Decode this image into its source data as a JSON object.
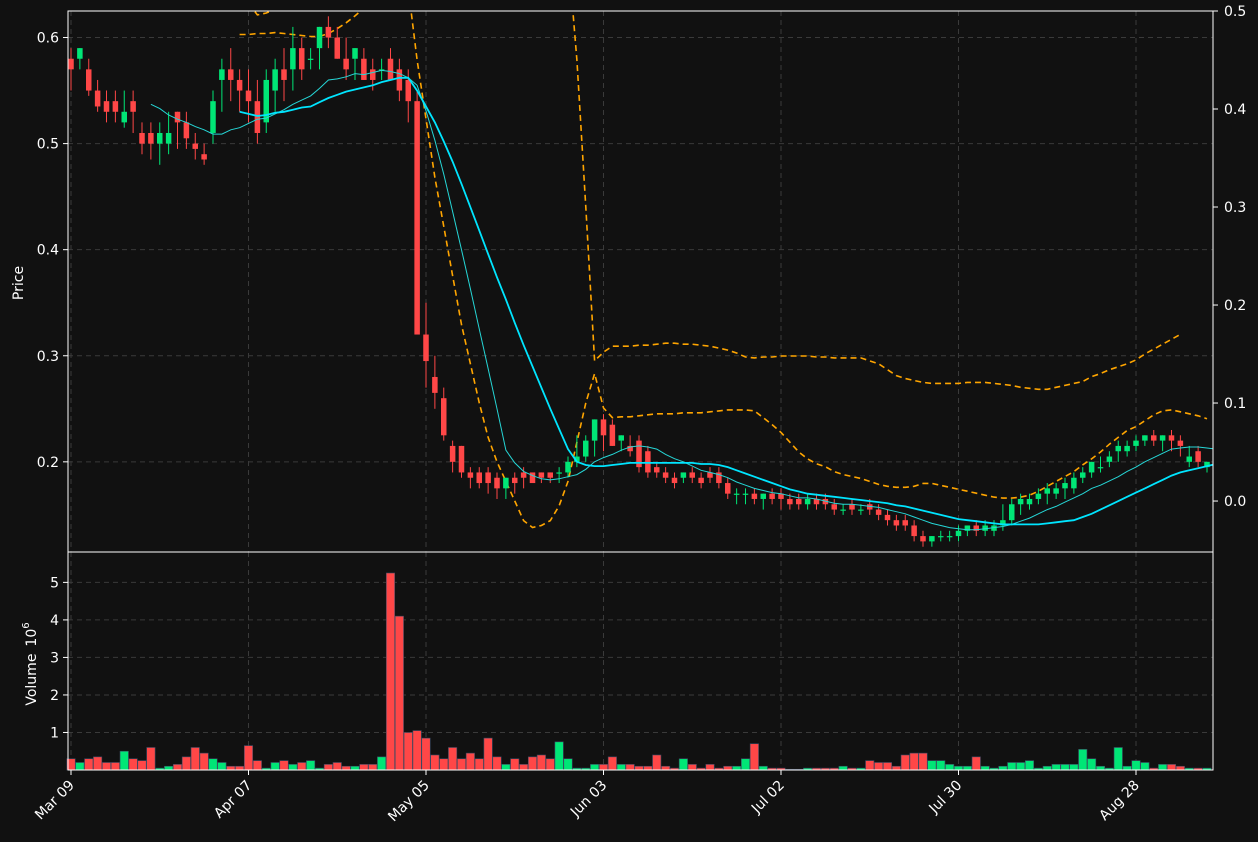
{
  "chart_data": {
    "type": "candlestick",
    "colors": {
      "background": "#111111",
      "up": "#00e676",
      "down": "#ff4747",
      "ma_fast": "#26d7d7",
      "ma_slow": "#00e5ff",
      "bands": "#ffa500",
      "axes": "#ffffff",
      "grid": "#3a3a3a"
    },
    "price_panel": {
      "ylabel": "Price",
      "ylim": [
        0.115,
        0.625
      ],
      "yticks": [
        "0.2",
        "0.3",
        "0.4",
        "0.5",
        "0.6"
      ],
      "right_ylim": [
        -0.052,
        0.5
      ],
      "right_yticks": [
        "0.0",
        "0.1",
        "0.2",
        "0.3",
        "0.4",
        "0.5"
      ]
    },
    "volume_panel": {
      "ylabel": "Volume",
      "ylabel_exponent": "10",
      "ylabel_exponent_power": "6",
      "ylim": [
        0,
        5.25
      ],
      "yticks": [
        "1",
        "2",
        "3",
        "4",
        "5"
      ]
    },
    "x_ticks": [
      {
        "index": 0,
        "label": "Mar 09"
      },
      {
        "index": 20,
        "label": "Apr 07"
      },
      {
        "index": 40,
        "label": "May 05"
      },
      {
        "index": 60,
        "label": "Jun 03"
      },
      {
        "index": 80,
        "label": "Jul 02"
      },
      {
        "index": 100,
        "label": "Jul 30"
      },
      {
        "index": 120,
        "label": "Aug 28"
      }
    ],
    "dates": [
      "2021-03-09",
      "2021-03-10",
      "2021-03-11",
      "2021-03-12",
      "2021-03-15",
      "2021-03-16",
      "2021-03-17",
      "2021-03-18",
      "2021-03-19",
      "2021-03-22",
      "2021-03-23",
      "2021-03-24",
      "2021-03-25",
      "2021-03-26",
      "2021-03-29",
      "2021-03-30",
      "2021-03-31",
      "2021-04-01",
      "2021-04-05",
      "2021-04-06",
      "2021-04-07",
      "2021-04-08",
      "2021-04-09",
      "2021-04-12",
      "2021-04-13",
      "2021-04-14",
      "2021-04-15",
      "2021-04-16",
      "2021-04-19",
      "2021-04-20",
      "2021-04-21",
      "2021-04-22",
      "2021-04-23",
      "2021-04-26",
      "2021-04-27",
      "2021-04-28",
      "2021-04-29",
      "2021-04-30",
      "2021-05-03",
      "2021-05-04",
      "2021-05-05",
      "2021-05-06",
      "2021-05-07",
      "2021-05-10",
      "2021-05-11",
      "2021-05-12",
      "2021-05-13",
      "2021-05-14",
      "2021-05-17",
      "2021-05-18",
      "2021-05-19",
      "2021-05-20",
      "2021-05-21",
      "2021-05-24",
      "2021-05-25",
      "2021-05-26",
      "2021-05-27",
      "2021-05-28",
      "2021-06-01",
      "2021-06-02",
      "2021-06-03",
      "2021-06-04",
      "2021-06-07",
      "2021-06-08",
      "2021-06-09",
      "2021-06-10",
      "2021-06-11",
      "2021-06-14",
      "2021-06-15",
      "2021-06-16",
      "2021-06-17",
      "2021-06-18",
      "2021-06-21",
      "2021-06-22",
      "2021-06-23",
      "2021-06-24",
      "2021-06-25",
      "2021-06-28",
      "2021-06-29",
      "2021-06-30",
      "2021-07-02",
      "2021-07-05",
      "2021-07-06",
      "2021-07-07",
      "2021-07-08",
      "2021-07-09",
      "2021-07-12",
      "2021-07-13",
      "2021-07-14",
      "2021-07-15",
      "2021-07-16",
      "2021-07-19",
      "2021-07-20",
      "2021-07-21",
      "2021-07-22",
      "2021-07-23",
      "2021-07-26",
      "2021-07-27",
      "2021-07-28",
      "2021-07-29",
      "2021-07-30",
      "2021-08-02",
      "2021-08-03",
      "2021-08-04",
      "2021-08-05",
      "2021-08-06",
      "2021-08-09",
      "2021-08-10",
      "2021-08-11",
      "2021-08-12",
      "2021-08-13",
      "2021-08-16",
      "2021-08-17",
      "2021-08-18",
      "2021-08-19",
      "2021-08-20",
      "2021-08-23",
      "2021-08-24",
      "2021-08-25",
      "2021-08-26",
      "2021-08-28",
      "2021-08-30",
      "2021-08-31",
      "2021-09-01",
      "2021-09-02",
      "2021-09-03",
      "2021-09-06",
      "2021-09-07"
    ],
    "open": [
      0.58,
      0.58,
      0.57,
      0.55,
      0.54,
      0.54,
      0.52,
      0.54,
      0.51,
      0.51,
      0.5,
      0.5,
      0.53,
      0.52,
      0.5,
      0.49,
      0.51,
      0.56,
      0.57,
      0.56,
      0.55,
      0.54,
      0.52,
      0.55,
      0.57,
      0.57,
      0.59,
      0.58,
      0.59,
      0.61,
      0.6,
      0.58,
      0.58,
      0.58,
      0.57,
      0.57,
      0.58,
      0.57,
      0.56,
      0.54,
      0.32,
      0.28,
      0.26,
      0.215,
      0.215,
      0.19,
      0.19,
      0.19,
      0.185,
      0.175,
      0.185,
      0.19,
      0.19,
      0.19,
      0.19,
      0.19,
      0.19,
      0.2,
      0.205,
      0.22,
      0.24,
      0.235,
      0.22,
      0.215,
      0.22,
      0.21,
      0.195,
      0.19,
      0.185,
      0.185,
      0.19,
      0.185,
      0.19,
      0.19,
      0.18,
      0.17,
      0.17,
      0.17,
      0.165,
      0.17,
      0.17,
      0.165,
      0.165,
      0.16,
      0.165,
      0.165,
      0.16,
      0.155,
      0.16,
      0.155,
      0.16,
      0.155,
      0.15,
      0.145,
      0.145,
      0.14,
      0.13,
      0.125,
      0.13,
      0.13,
      0.13,
      0.135,
      0.14,
      0.135,
      0.135,
      0.14,
      0.145,
      0.16,
      0.16,
      0.165,
      0.17,
      0.17,
      0.175,
      0.175,
      0.185,
      0.19,
      0.195,
      0.2,
      0.21,
      0.21,
      0.215,
      0.22,
      0.225,
      0.22,
      0.225,
      0.22,
      0.2,
      0.21,
      0.195
    ],
    "high": [
      0.59,
      0.59,
      0.58,
      0.56,
      0.55,
      0.55,
      0.55,
      0.55,
      0.52,
      0.52,
      0.52,
      0.53,
      0.53,
      0.53,
      0.51,
      0.5,
      0.55,
      0.58,
      0.59,
      0.57,
      0.57,
      0.56,
      0.57,
      0.58,
      0.59,
      0.61,
      0.6,
      0.59,
      0.61,
      0.62,
      0.61,
      0.6,
      0.59,
      0.59,
      0.58,
      0.58,
      0.59,
      0.58,
      0.57,
      0.55,
      0.35,
      0.3,
      0.27,
      0.22,
      0.215,
      0.195,
      0.195,
      0.195,
      0.19,
      0.185,
      0.19,
      0.195,
      0.19,
      0.19,
      0.19,
      0.195,
      0.205,
      0.225,
      0.225,
      0.24,
      0.245,
      0.24,
      0.225,
      0.225,
      0.225,
      0.215,
      0.2,
      0.195,
      0.19,
      0.19,
      0.195,
      0.19,
      0.195,
      0.195,
      0.185,
      0.175,
      0.175,
      0.175,
      0.17,
      0.175,
      0.175,
      0.17,
      0.17,
      0.17,
      0.17,
      0.17,
      0.165,
      0.16,
      0.165,
      0.16,
      0.165,
      0.16,
      0.155,
      0.15,
      0.15,
      0.145,
      0.135,
      0.13,
      0.135,
      0.135,
      0.14,
      0.14,
      0.145,
      0.145,
      0.145,
      0.16,
      0.165,
      0.17,
      0.17,
      0.175,
      0.18,
      0.18,
      0.185,
      0.19,
      0.195,
      0.2,
      0.205,
      0.21,
      0.22,
      0.22,
      0.225,
      0.225,
      0.23,
      0.225,
      0.23,
      0.225,
      0.215,
      0.215,
      0.2
    ],
    "low": [
      0.55,
      0.57,
      0.545,
      0.53,
      0.52,
      0.52,
      0.515,
      0.51,
      0.49,
      0.485,
      0.48,
      0.49,
      0.495,
      0.495,
      0.485,
      0.48,
      0.5,
      0.53,
      0.54,
      0.53,
      0.52,
      0.5,
      0.51,
      0.53,
      0.54,
      0.55,
      0.56,
      0.57,
      0.57,
      0.59,
      0.58,
      0.56,
      0.56,
      0.56,
      0.55,
      0.56,
      0.56,
      0.54,
      0.52,
      0.53,
      0.27,
      0.25,
      0.22,
      0.19,
      0.185,
      0.175,
      0.175,
      0.17,
      0.165,
      0.165,
      0.17,
      0.175,
      0.18,
      0.18,
      0.18,
      0.18,
      0.185,
      0.195,
      0.2,
      0.205,
      0.21,
      0.215,
      0.21,
      0.205,
      0.19,
      0.185,
      0.185,
      0.18,
      0.175,
      0.18,
      0.18,
      0.175,
      0.18,
      0.175,
      0.165,
      0.16,
      0.16,
      0.16,
      0.155,
      0.16,
      0.155,
      0.155,
      0.155,
      0.155,
      0.155,
      0.155,
      0.15,
      0.15,
      0.15,
      0.15,
      0.15,
      0.145,
      0.14,
      0.135,
      0.135,
      0.125,
      0.12,
      0.12,
      0.125,
      0.125,
      0.125,
      0.13,
      0.13,
      0.13,
      0.13,
      0.135,
      0.14,
      0.15,
      0.155,
      0.16,
      0.16,
      0.165,
      0.165,
      0.17,
      0.18,
      0.185,
      0.19,
      0.195,
      0.2,
      0.205,
      0.21,
      0.215,
      0.215,
      0.21,
      0.21,
      0.205,
      0.195,
      0.195,
      0.19
    ],
    "close": [
      0.57,
      0.59,
      0.55,
      0.535,
      0.53,
      0.53,
      0.53,
      0.53,
      0.5,
      0.5,
      0.51,
      0.51,
      0.52,
      0.505,
      0.495,
      0.485,
      0.54,
      0.57,
      0.56,
      0.55,
      0.54,
      0.51,
      0.56,
      0.57,
      0.56,
      0.59,
      0.57,
      0.58,
      0.61,
      0.6,
      0.58,
      0.57,
      0.59,
      0.56,
      0.56,
      0.57,
      0.56,
      0.55,
      0.54,
      0.32,
      0.295,
      0.265,
      0.225,
      0.2,
      0.19,
      0.185,
      0.18,
      0.18,
      0.175,
      0.185,
      0.18,
      0.185,
      0.18,
      0.185,
      0.185,
      0.19,
      0.2,
      0.205,
      0.22,
      0.24,
      0.225,
      0.215,
      0.225,
      0.21,
      0.195,
      0.19,
      0.19,
      0.185,
      0.18,
      0.19,
      0.185,
      0.18,
      0.185,
      0.18,
      0.17,
      0.17,
      0.17,
      0.165,
      0.17,
      0.165,
      0.165,
      0.16,
      0.16,
      0.165,
      0.16,
      0.16,
      0.155,
      0.155,
      0.155,
      0.155,
      0.155,
      0.15,
      0.145,
      0.14,
      0.14,
      0.13,
      0.125,
      0.13,
      0.13,
      0.13,
      0.135,
      0.14,
      0.135,
      0.14,
      0.14,
      0.145,
      0.16,
      0.165,
      0.165,
      0.17,
      0.175,
      0.175,
      0.18,
      0.185,
      0.19,
      0.2,
      0.195,
      0.205,
      0.215,
      0.215,
      0.22,
      0.225,
      0.22,
      0.225,
      0.22,
      0.215,
      0.205,
      0.2,
      0.2
    ],
    "volume": [
      0.3,
      0.2,
      0.3,
      0.35,
      0.2,
      0.2,
      0.5,
      0.3,
      0.25,
      0.6,
      0.05,
      0.1,
      0.15,
      0.35,
      0.6,
      0.45,
      0.3,
      0.2,
      0.1,
      0.1,
      0.65,
      0.25,
      0.05,
      0.2,
      0.25,
      0.15,
      0.2,
      0.25,
      0.05,
      0.15,
      0.2,
      0.1,
      0.1,
      0.15,
      0.15,
      0.35,
      5.25,
      4.1,
      1.0,
      1.05,
      0.85,
      0.4,
      0.3,
      0.6,
      0.3,
      0.45,
      0.3,
      0.85,
      0.35,
      0.15,
      0.3,
      0.15,
      0.35,
      0.4,
      0.3,
      0.75,
      0.3,
      0.05,
      0.05,
      0.15,
      0.15,
      0.35,
      0.15,
      0.15,
      0.1,
      0.1,
      0.4,
      0.1,
      0.05,
      0.3,
      0.15,
      0.05,
      0.15,
      0.05,
      0.1,
      0.1,
      0.3,
      0.7,
      0.1,
      0.05,
      0.05,
      0.02,
      0.02,
      0.05,
      0.05,
      0.05,
      0.05,
      0.1,
      0.05,
      0.05,
      0.25,
      0.2,
      0.2,
      0.1,
      0.4,
      0.45,
      0.45,
      0.25,
      0.25,
      0.15,
      0.1,
      0.1,
      0.35,
      0.1,
      0.05,
      0.1,
      0.2,
      0.2,
      0.25,
      0.05,
      0.1,
      0.15,
      0.15,
      0.15,
      0.55,
      0.3,
      0.1,
      0.05,
      0.6,
      0.1,
      0.25,
      0.2,
      0.05,
      0.15,
      0.15,
      0.1,
      0.05,
      0.05,
      0.05
    ],
    "ma_fast": [
      null,
      null,
      null,
      null,
      null,
      null,
      null,
      null,
      null,
      0.537,
      0.533,
      0.527,
      0.523,
      0.52,
      0.516,
      0.513,
      0.509,
      0.509,
      0.513,
      0.515,
      0.519,
      0.523,
      0.524,
      0.528,
      0.532,
      0.537,
      0.541,
      0.545,
      0.552,
      0.56,
      0.561,
      0.563,
      0.566,
      0.565,
      0.567,
      0.569,
      0.568,
      0.566,
      0.562,
      0.555,
      0.531,
      0.503,
      0.471,
      0.436,
      0.4,
      0.363,
      0.325,
      0.288,
      0.25,
      0.211,
      0.199,
      0.191,
      0.187,
      0.184,
      0.183,
      0.184,
      0.186,
      0.188,
      0.193,
      0.2,
      0.204,
      0.207,
      0.211,
      0.214,
      0.215,
      0.214,
      0.212,
      0.207,
      0.203,
      0.2,
      0.196,
      0.192,
      0.19,
      0.188,
      0.185,
      0.181,
      0.178,
      0.175,
      0.173,
      0.171,
      0.17,
      0.168,
      0.166,
      0.166,
      0.165,
      0.163,
      0.161,
      0.16,
      0.16,
      0.159,
      0.158,
      0.157,
      0.155,
      0.153,
      0.151,
      0.148,
      0.145,
      0.142,
      0.14,
      0.138,
      0.137,
      0.136,
      0.136,
      0.137,
      0.138,
      0.139,
      0.141,
      0.144,
      0.147,
      0.151,
      0.155,
      0.158,
      0.162,
      0.166,
      0.17,
      0.175,
      0.178,
      0.182,
      0.186,
      0.191,
      0.195,
      0.2,
      0.204,
      0.208,
      0.212,
      0.213,
      0.214,
      0.214,
      0.213,
      0.212,
      0.211
    ],
    "ma_slow": [
      null,
      null,
      null,
      null,
      null,
      null,
      null,
      null,
      null,
      null,
      null,
      null,
      null,
      null,
      null,
      null,
      null,
      null,
      null,
      0.53,
      0.528,
      0.526,
      0.527,
      0.529,
      0.53,
      0.532,
      0.534,
      0.535,
      0.539,
      0.543,
      0.546,
      0.549,
      0.551,
      0.553,
      0.555,
      0.558,
      0.56,
      0.562,
      0.562,
      0.55,
      0.535,
      0.52,
      0.502,
      0.483,
      0.462,
      0.44,
      0.418,
      0.396,
      0.374,
      0.353,
      0.331,
      0.31,
      0.29,
      0.27,
      0.25,
      0.231,
      0.212,
      0.2,
      0.197,
      0.196,
      0.196,
      0.197,
      0.198,
      0.199,
      0.199,
      0.199,
      0.199,
      0.199,
      0.199,
      0.199,
      0.199,
      0.198,
      0.198,
      0.197,
      0.195,
      0.192,
      0.189,
      0.186,
      0.183,
      0.18,
      0.177,
      0.174,
      0.172,
      0.17,
      0.169,
      0.168,
      0.167,
      0.166,
      0.165,
      0.164,
      0.163,
      0.162,
      0.161,
      0.159,
      0.158,
      0.156,
      0.154,
      0.152,
      0.15,
      0.148,
      0.146,
      0.145,
      0.144,
      0.143,
      0.142,
      0.141,
      0.141,
      0.141,
      0.141,
      0.141,
      0.142,
      0.143,
      0.144,
      0.145,
      0.148,
      0.151,
      0.155,
      0.159,
      0.163,
      0.167,
      0.171,
      0.175,
      0.179,
      0.183,
      0.187,
      0.19,
      0.192,
      0.194,
      0.196,
      0.198,
      0.2
    ],
    "band_upper": [
      null,
      null,
      null,
      null,
      null,
      null,
      null,
      null,
      null,
      null,
      null,
      null,
      null,
      null,
      null,
      null,
      null,
      null,
      null,
      0.511,
      0.508,
      0.496,
      0.498,
      0.502,
      0.506,
      0.513,
      0.521,
      0.527,
      0.534,
      0.539,
      0.54,
      0.541,
      0.543,
      0.544,
      0.543,
      0.538,
      0.53,
      0.52,
      0.505,
      0.7,
      0.8,
      0.8,
      0.8,
      0.8,
      0.8,
      0.8,
      0.8,
      0.8,
      0.8,
      0.8,
      0.8,
      0.8,
      0.8,
      0.8,
      0.75,
      0.68,
      0.56,
      0.45,
      0.3,
      0.143,
      0.152,
      0.158,
      0.158,
      0.158,
      0.159,
      0.159,
      0.16,
      0.161,
      0.161,
      0.16,
      0.16,
      0.159,
      0.158,
      0.156,
      0.154,
      0.151,
      0.147,
      0.146,
      0.147,
      0.147,
      0.148,
      0.148,
      0.148,
      0.148,
      0.147,
      0.147,
      0.146,
      0.146,
      0.146,
      0.146,
      0.143,
      0.14,
      0.134,
      0.128,
      0.125,
      0.123,
      0.121,
      0.12,
      0.12,
      0.12,
      0.12,
      0.121,
      0.121,
      0.121,
      0.12,
      0.119,
      0.118,
      0.116,
      0.115,
      0.114,
      0.114,
      0.116,
      0.118,
      0.12,
      0.122,
      0.127,
      0.13,
      0.134,
      0.137,
      0.14,
      0.144,
      0.15,
      0.155,
      0.16,
      0.165,
      0.17
    ],
    "band_lower": [
      null,
      null,
      null,
      null,
      null,
      null,
      null,
      null,
      null,
      null,
      null,
      null,
      null,
      null,
      null,
      null,
      null,
      null,
      null,
      0.476,
      0.476,
      0.477,
      0.477,
      0.478,
      0.477,
      0.476,
      0.475,
      0.474,
      0.474,
      0.477,
      0.482,
      0.488,
      0.495,
      0.503,
      0.508,
      0.517,
      0.523,
      0.525,
      0.523,
      0.45,
      0.39,
      0.33,
      0.28,
      0.23,
      0.18,
      0.14,
      0.1,
      0.065,
      0.04,
      0.02,
      0.0,
      -0.02,
      -0.027,
      -0.025,
      -0.02,
      -0.005,
      0.02,
      0.06,
      0.1,
      0.13,
      0.095,
      0.085,
      0.086,
      0.086,
      0.087,
      0.088,
      0.089,
      0.089,
      0.089,
      0.09,
      0.09,
      0.09,
      0.091,
      0.092,
      0.093,
      0.093,
      0.093,
      0.092,
      0.085,
      0.078,
      0.07,
      0.06,
      0.05,
      0.043,
      0.038,
      0.035,
      0.03,
      0.027,
      0.025,
      0.023,
      0.02,
      0.017,
      0.015,
      0.014,
      0.014,
      0.015,
      0.018,
      0.018,
      0.016,
      0.014,
      0.012,
      0.01,
      0.008,
      0.006,
      0.004,
      0.003,
      0.003,
      0.004,
      0.006,
      0.01,
      0.015,
      0.02,
      0.025,
      0.03,
      0.037,
      0.043,
      0.05,
      0.058,
      0.065,
      0.072,
      0.076,
      0.082,
      0.088,
      0.092,
      0.093,
      0.091,
      0.089,
      0.087,
      0.084
    ]
  }
}
